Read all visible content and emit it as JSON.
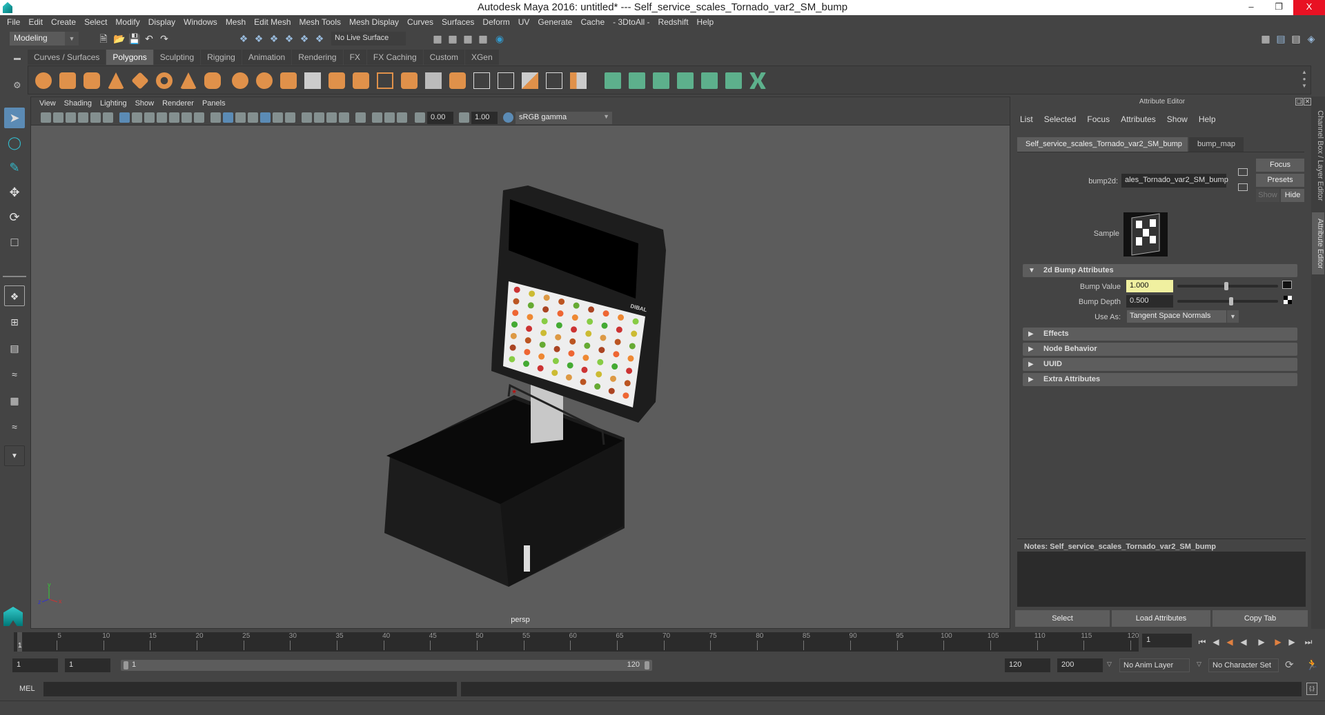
{
  "window": {
    "title": "Autodesk Maya 2016: untitled*   ---   Self_service_scales_Tornado_var2_SM_bump",
    "minimize": "–",
    "restore": "❐",
    "close": "X"
  },
  "menubar": [
    "File",
    "Edit",
    "Create",
    "Select",
    "Modify",
    "Display",
    "Windows",
    "Mesh",
    "Edit Mesh",
    "Mesh Tools",
    "Mesh Display",
    "Curves",
    "Surfaces",
    "Deform",
    "UV",
    "Generate",
    "Cache",
    "- 3DtoAll -",
    "Redshift",
    "Help"
  ],
  "statusline": {
    "mode": "Modeling",
    "live_surface": "No Live Surface"
  },
  "shelf": {
    "tabs": [
      "Curves / Surfaces",
      "Polygons",
      "Sculpting",
      "Rigging",
      "Animation",
      "Rendering",
      "FX",
      "FX Caching",
      "Custom",
      "XGen"
    ],
    "active_tab": "Polygons"
  },
  "viewport": {
    "menu": [
      "View",
      "Shading",
      "Lighting",
      "Show",
      "Renderer",
      "Panels"
    ],
    "exposure": "0.00",
    "gamma": "1.00",
    "color_space": "sRGB gamma",
    "camera_label": "persp",
    "object_brand": "DIBAL",
    "axis": {
      "x": "x",
      "y": "y",
      "z": "z"
    }
  },
  "attribute_editor": {
    "header": "Attribute Editor",
    "menu": [
      "List",
      "Selected",
      "Focus",
      "Attributes",
      "Show",
      "Help"
    ],
    "tabs": [
      "Self_service_scales_Tornado_var2_SM_bump",
      "bump_map"
    ],
    "node_type_label": "bump2d:",
    "node_name": "ales_Tornado_var2_SM_bump",
    "buttons": {
      "focus": "Focus",
      "presets": "Presets",
      "show": "Show",
      "hide": "Hide"
    },
    "sample_label": "Sample",
    "sections": {
      "bump": {
        "title": "2d Bump Attributes",
        "bump_value_label": "Bump Value",
        "bump_value": "1.000",
        "bump_depth_label": "Bump Depth",
        "bump_depth": "0.500",
        "use_as_label": "Use As:",
        "use_as": "Tangent Space Normals"
      },
      "collapsed": [
        "Effects",
        "Node Behavior",
        "UUID",
        "Extra Attributes"
      ]
    },
    "notes_label": "Notes:  Self_service_scales_Tornado_var2_SM_bump",
    "notes_value": "",
    "bottom_buttons": [
      "Select",
      "Load Attributes",
      "Copy Tab"
    ]
  },
  "side_tabs": [
    "Channel Box / Layer Editor",
    "Attribute Editor"
  ],
  "timeslider": {
    "ticks": [
      5,
      10,
      15,
      20,
      25,
      30,
      35,
      40,
      45,
      50,
      55,
      60,
      65,
      70,
      75,
      80,
      85,
      90,
      95,
      100,
      105,
      110,
      115,
      120
    ],
    "current_frame_marker": "1",
    "current_frame": "1"
  },
  "range": {
    "start": "1",
    "playback_start": "1",
    "range_start": "1",
    "range_end": "120",
    "playback_end": "120",
    "end": "200",
    "anim_layer": "No Anim Layer",
    "character_set": "No Character Set"
  },
  "command_line": {
    "language": "MEL",
    "input": "",
    "result": ""
  }
}
